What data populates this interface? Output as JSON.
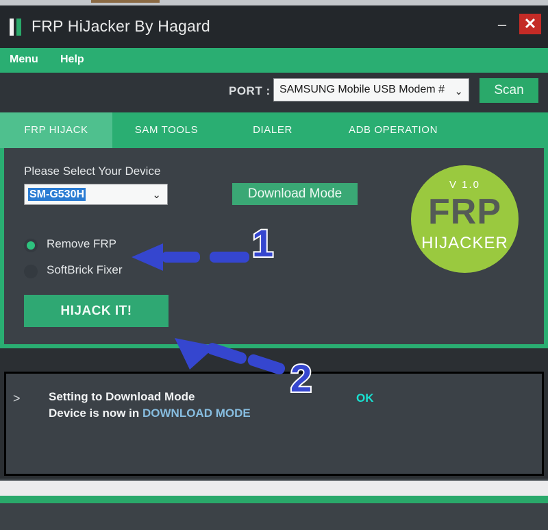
{
  "window": {
    "title": "FRP HiJacker By Hagard",
    "logo_icon": "frp-bars-logo",
    "minimize_label": "–",
    "close_label": "✕"
  },
  "menu": {
    "items": [
      {
        "label": "Menu"
      },
      {
        "label": "Help"
      }
    ]
  },
  "port_row": {
    "label": "PORT :",
    "selected": "SAMSUNG Mobile USB Modem #",
    "chevron": "⌄",
    "scan_label": "Scan"
  },
  "tabs": [
    {
      "label": "FRP HIJACK",
      "active": true
    },
    {
      "label": "SAM TOOLS",
      "active": false
    },
    {
      "label": "DIALER",
      "active": false
    },
    {
      "label": "ADB OPERATION",
      "active": false
    }
  ],
  "main": {
    "device_label": "Please Select Your Device",
    "device_selected": "SM-G530H",
    "device_chevron": "⌄",
    "download_mode_label": "Download Mode",
    "options": [
      {
        "label": "Remove FRP",
        "selected": true
      },
      {
        "label": "SoftBrick Fixer",
        "selected": false
      }
    ],
    "hijack_label": "HIJACK IT!"
  },
  "logo": {
    "version": "V 1.0",
    "title": "FRP",
    "subtitle": "HIJACKER",
    "color": "#9ac93f"
  },
  "console": {
    "prompt": ">",
    "line1": "Setting to Download Mode",
    "line2_prefix": "Device is now in ",
    "line2_highlight": "DOWNLOAD MODE",
    "status": "OK",
    "status_color": "#19e0d0"
  },
  "annotations": [
    {
      "label": "1"
    },
    {
      "label": "2"
    }
  ],
  "colors": {
    "accent_green": "#2aae72",
    "panel_dark": "#3b4147",
    "title_dark": "#23272b",
    "annotation_blue": "#3546cf",
    "close_red": "#c42b26"
  }
}
